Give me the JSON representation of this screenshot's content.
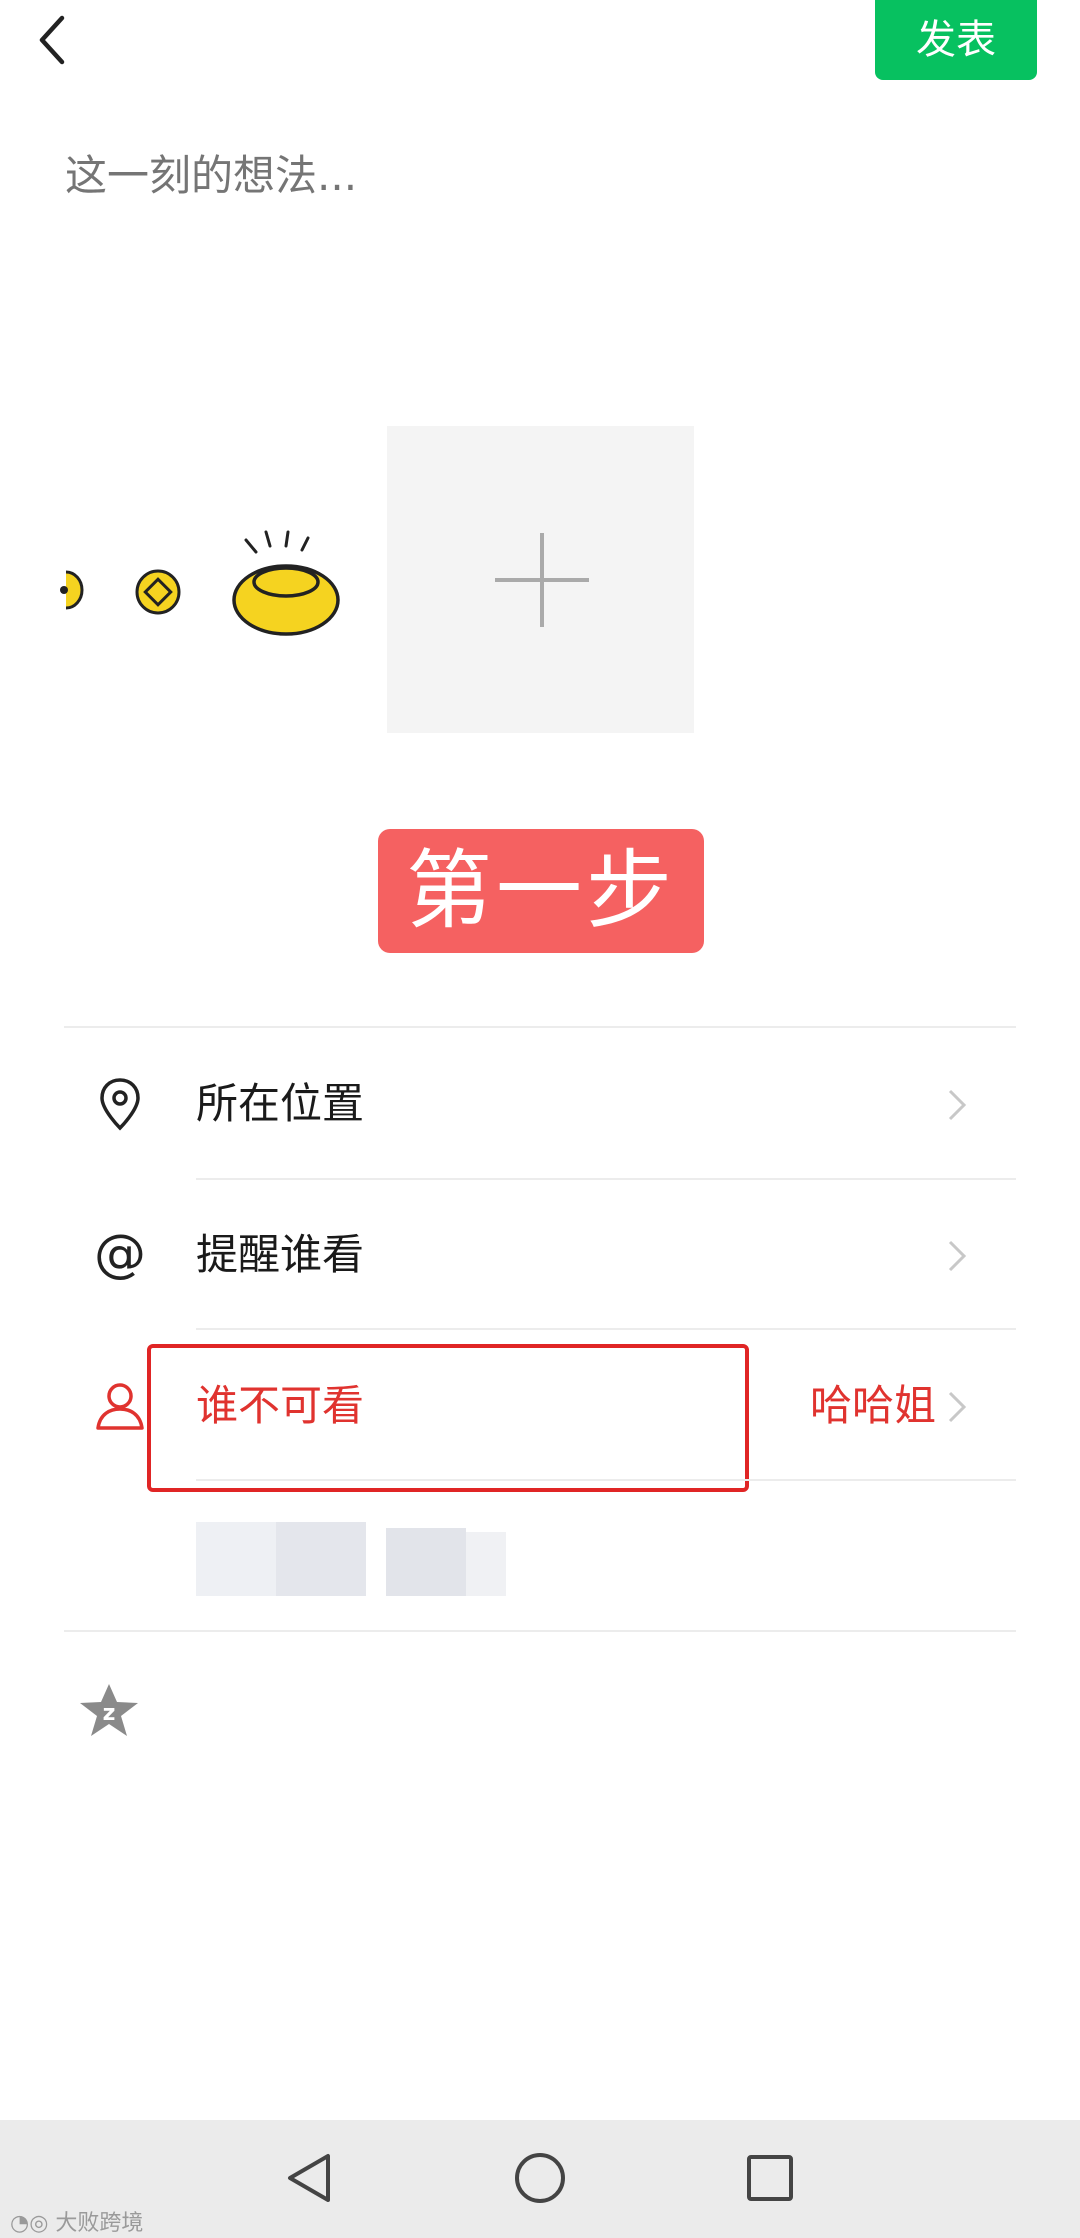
{
  "header": {
    "publish_label": "发表"
  },
  "compose": {
    "placeholder": "这一刻的想法..."
  },
  "step_badge": "第一步",
  "options": {
    "location": {
      "label": "所在位置"
    },
    "mention": {
      "label": "提醒谁看"
    },
    "privacy": {
      "label": "谁不可看",
      "value": "哈哈姐"
    }
  },
  "watermark": "大败跨境",
  "colors": {
    "accent_green": "#07c160",
    "highlight_red": "#e02525",
    "badge_red": "#f56161"
  }
}
